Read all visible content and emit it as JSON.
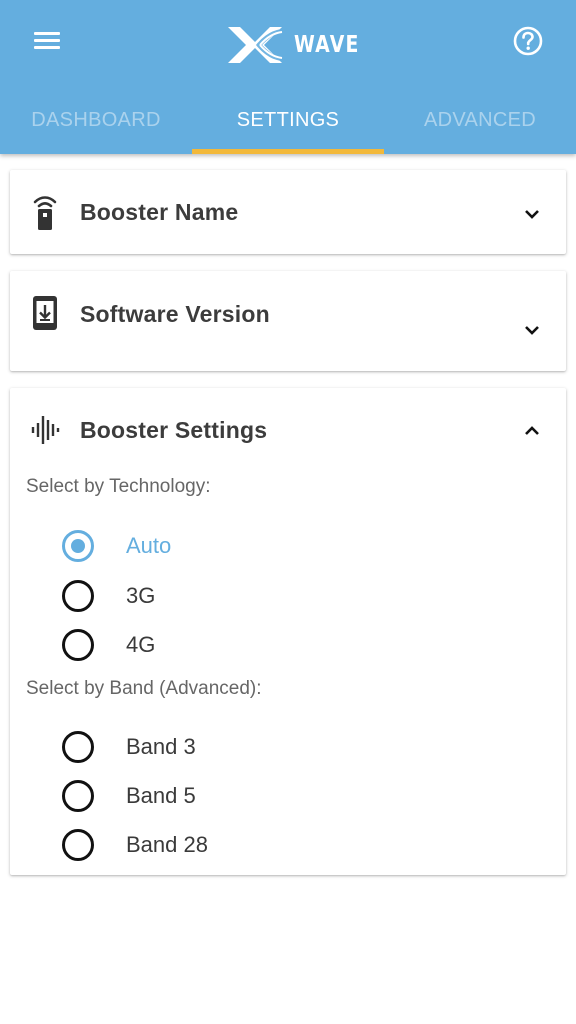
{
  "header": {
    "logo_text": "WAVE",
    "menu_icon": "hamburger-menu-icon",
    "help_icon": "help-circle-icon",
    "color": "#64aedf",
    "indicator_color": "#f2b83a"
  },
  "tabs": [
    {
      "label": "DASHBOARD",
      "active": false
    },
    {
      "label": "SETTINGS",
      "active": true
    },
    {
      "label": "ADVANCED",
      "active": false
    }
  ],
  "cards": {
    "booster_name": {
      "title": "Booster Name",
      "icon": "booster-device-icon",
      "expanded": false
    },
    "software_version": {
      "title": "Software Version",
      "icon": "phone-download-icon",
      "expanded": false
    },
    "booster_settings": {
      "title": "Booster Settings",
      "icon": "signal-waveform-icon",
      "expanded": true,
      "technology_label": "Select by Technology:",
      "technology_options": [
        {
          "label": "Auto",
          "selected": true
        },
        {
          "label": "3G",
          "selected": false
        },
        {
          "label": "4G",
          "selected": false
        }
      ],
      "band_label": "Select by Band (Advanced):",
      "band_options": [
        {
          "label": "Band 3",
          "selected": false
        },
        {
          "label": "Band 5",
          "selected": false
        },
        {
          "label": "Band 28",
          "selected": false
        }
      ]
    }
  }
}
